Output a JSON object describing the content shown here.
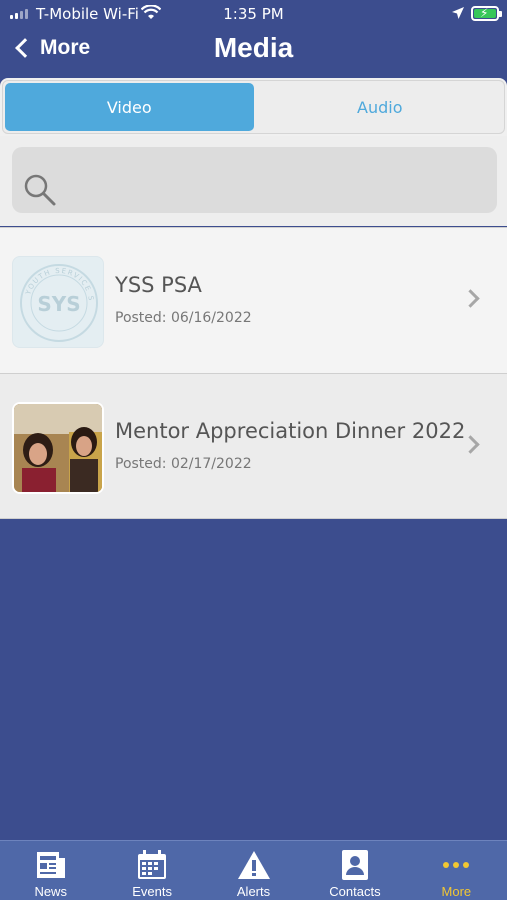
{
  "status": {
    "carrier": "T-Mobile Wi-Fi",
    "time": "1:35 PM",
    "battery_color": "#37c759"
  },
  "nav": {
    "back_label": "More",
    "title": "Media"
  },
  "segments": {
    "video": "Video",
    "audio": "Audio",
    "active": "video"
  },
  "search": {
    "icon": "search-icon"
  },
  "media_items": [
    {
      "title": "YSS PSA",
      "posted": "Posted: 06/16/2022",
      "thumb_text": "YOUTH SERVICE SYSTEM",
      "thumb_mark": "SYS"
    },
    {
      "title": "Mentor Appreciation Dinner 2022",
      "posted": "Posted: 02/17/2022"
    }
  ],
  "tabs": [
    {
      "label": "News",
      "icon": "newspaper-icon"
    },
    {
      "label": "Events",
      "icon": "calendar-icon"
    },
    {
      "label": "Alerts",
      "icon": "warning-icon"
    },
    {
      "label": "Contacts",
      "icon": "contact-card-icon"
    },
    {
      "label": "More",
      "icon": "more-dots-icon",
      "active": true
    }
  ],
  "colors": {
    "background": "#3c4d8e",
    "accent": "#4fa9dc",
    "tab_bar": "#4f68a8",
    "tab_active": "#f2c733"
  }
}
